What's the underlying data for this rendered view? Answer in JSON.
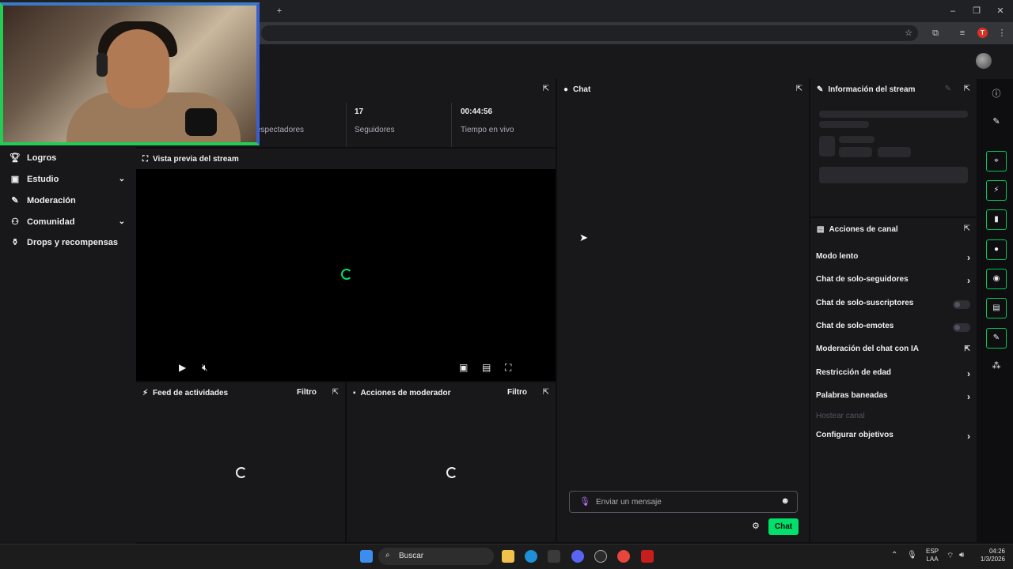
{
  "browser": {
    "new_tab": "+",
    "window_min": "–",
    "window_max": "❐",
    "window_close": "✕",
    "profile_initial": "T"
  },
  "sidebar": {
    "items": [
      {
        "label": "Logros",
        "icon": "trophy-icon",
        "expandable": false
      },
      {
        "label": "Estudio",
        "icon": "camera-icon",
        "expandable": true
      },
      {
        "label": "Moderación",
        "icon": "wrench-icon",
        "expandable": false
      },
      {
        "label": "Comunidad",
        "icon": "people-icon",
        "expandable": true
      },
      {
        "label": "Drops y recompensas",
        "icon": "gift-icon",
        "expandable": false
      }
    ]
  },
  "stats": {
    "viewers_label": "espectadores",
    "followers_value": "17",
    "followers_label": "Seguidores",
    "live_value": "00:44:56",
    "live_label": "Tiempo en vivo"
  },
  "preview": {
    "title": "Vista previa del stream"
  },
  "feed": {
    "title": "Feed de actividades",
    "filter": "Filtro"
  },
  "mod_actions": {
    "title": "Acciones de moderador",
    "filter": "Filtro"
  },
  "chat": {
    "title": "Chat",
    "input_placeholder": "Enviar un mensaje",
    "send_label": "Chat"
  },
  "stream_info": {
    "title": "Información del stream"
  },
  "channel_actions": {
    "title": "Acciones de canal",
    "items": [
      {
        "label": "Modo lento",
        "control": "arrow"
      },
      {
        "label": "Chat de solo-seguidores",
        "control": "arrow"
      },
      {
        "label": "Chat de solo-suscriptores",
        "control": "toggle",
        "enabled": false
      },
      {
        "label": "Chat de solo-emotes",
        "control": "toggle",
        "enabled": false
      },
      {
        "label": "Moderación del chat con IA",
        "control": "external"
      },
      {
        "label": "Restricción de edad",
        "control": "arrow"
      },
      {
        "label": "Palabras baneadas",
        "control": "arrow"
      },
      {
        "label": "Hostear canal",
        "control": "disabled"
      },
      {
        "label": "Configurar objetivos",
        "control": "arrow"
      }
    ]
  },
  "taskbar": {
    "search_label": "Buscar",
    "lang_top": "ESP",
    "lang_bottom": "LAA",
    "time": "04:26",
    "date": "1/3/2026"
  },
  "colors": {
    "accent": "#00e06a",
    "panel": "#18181b",
    "background": "#0e0e10"
  }
}
